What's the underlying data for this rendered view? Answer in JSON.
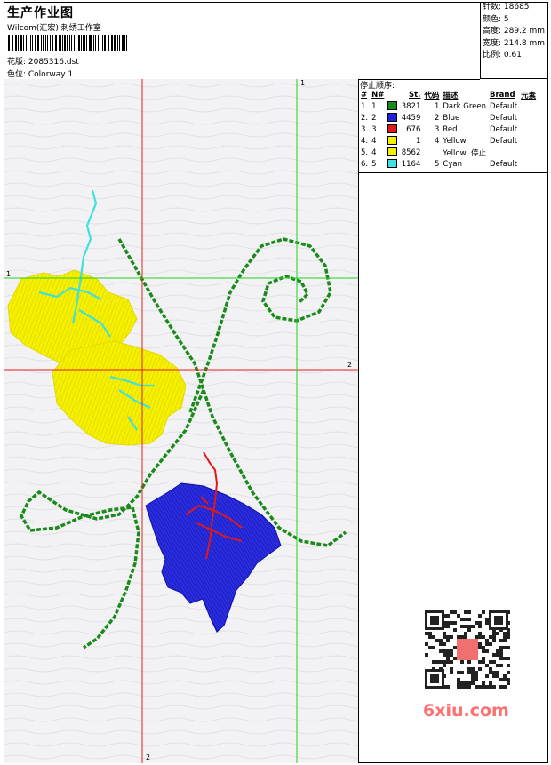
{
  "header": {
    "title": "生产作业图",
    "subtitle": "Wilcom(汇宏) 刺绣工作室",
    "design_label": "花版: 2085316.dst",
    "colorway_label": "色位:   Colorway 1"
  },
  "stats": {
    "stitches": "针数: 18685",
    "colors": "颜色: 5",
    "height": "高度: 289.2 mm",
    "width": "宽度: 214.8 mm",
    "scale": "比例: 0.61"
  },
  "stop_sequence": {
    "title": "停止顺序:",
    "headers": [
      "#",
      "N#",
      "St.",
      "代码",
      "描述",
      "Brand",
      "元素"
    ],
    "rows": [
      {
        "idx": "1.",
        "n": "1",
        "color": "#1a8a1a",
        "stitches": "3821",
        "code": "1",
        "desc": "Dark Green",
        "brand": "Default"
      },
      {
        "idx": "2.",
        "n": "2",
        "color": "#1c22d6",
        "stitches": "4459",
        "code": "2",
        "desc": "Blue",
        "brand": "Default"
      },
      {
        "idx": "3.",
        "n": "3",
        "color": "#e01818",
        "stitches": "676",
        "code": "3",
        "desc": "Red",
        "brand": "Default"
      },
      {
        "idx": "4.",
        "n": "4",
        "color": "#f5f000",
        "stitches": "1",
        "code": "4",
        "desc": "Yellow",
        "brand": "Default"
      },
      {
        "idx": "5.",
        "n": "4",
        "color": "#f5f000",
        "stitches": "8562",
        "code": "",
        "desc": "Yellow, 停止",
        "brand": ""
      },
      {
        "idx": "6.",
        "n": "5",
        "color": "#3fe0e0",
        "stitches": "1164",
        "code": "5",
        "desc": "Cyan",
        "brand": "Default"
      }
    ]
  },
  "axis_labels": {
    "green_v_top": "1",
    "green_h_left": "1",
    "red_h_right": "2",
    "red_v_bottom": "2"
  },
  "watermark": {
    "site": "6xiu.com"
  },
  "colors": {
    "green_thread": "#1a8a1a",
    "blue_thread": "#1c22d6",
    "red_thread": "#e01818",
    "yellow_thread": "#f5f000",
    "cyan_thread": "#3fe0e0",
    "guide_red": "#e02020",
    "guide_green": "#20d020"
  }
}
